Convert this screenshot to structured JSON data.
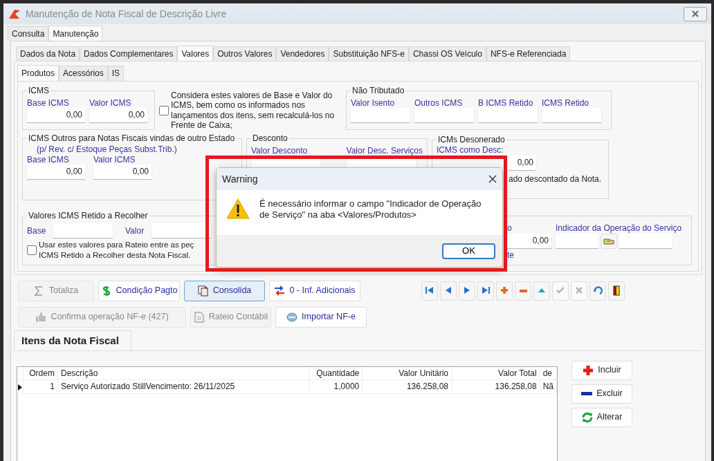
{
  "window": {
    "title": "Manutenção de Nota Fiscal de Descrição Livre"
  },
  "main_tabs": [
    {
      "label": "Consulta",
      "selected": false
    },
    {
      "label": "Manutenção",
      "selected": true
    }
  ],
  "section_tabs": [
    {
      "label": "Dados da Nota",
      "selected": false
    },
    {
      "label": "Dados Complementares",
      "selected": false
    },
    {
      "label": "Valores",
      "selected": true
    },
    {
      "label": "Outros Valores",
      "selected": false
    },
    {
      "label": "Vendedores",
      "selected": false
    },
    {
      "label": "Substituição NFS-e",
      "selected": false
    },
    {
      "label": "Chassi OS Veículo",
      "selected": false
    },
    {
      "label": "NFS-e Referenciada",
      "selected": false
    }
  ],
  "sub_tabs": [
    {
      "label": "Produtos",
      "selected": true
    },
    {
      "label": "Acessórios",
      "selected": false
    },
    {
      "label": "IS",
      "selected": false
    }
  ],
  "icms": {
    "title": "ICMS",
    "fields": [
      {
        "label": "Base ICMS",
        "value": "0,00"
      },
      {
        "label": "Valor ICMS",
        "value": "0,00"
      }
    ]
  },
  "considera": {
    "checked": false,
    "text": "Considera estes valores de Base e Valor do ICMS, bem como os informados nos lançamentos dos itens, sem recalculá-los no Frente de Caixa;"
  },
  "nao_tributado": {
    "title": "Não Tributado",
    "fields": [
      {
        "label": "Valor Isento"
      },
      {
        "label": "Outros ICMS"
      },
      {
        "label": "B ICMS Retido"
      },
      {
        "label": "ICMS Retido"
      }
    ]
  },
  "icms_outros": {
    "title": "ICMS Outros para Notas Fiscais vindas de outro Estado",
    "subtitle": "(p/ Rev. c/ Estoque Peças Subst.Trib.)",
    "fields": [
      {
        "label": "Base ICMS",
        "value": "0,00"
      },
      {
        "label": "Valor ICMS",
        "value": "0,00"
      }
    ]
  },
  "desconto": {
    "title": "Desconto",
    "fields": [
      {
        "label": "Valor Desconto"
      },
      {
        "label": "Valor Desc. Serviços"
      }
    ]
  },
  "icms_desonerado": {
    "title": "ICMs Desonerado",
    "label": "ICMS como Desc:",
    "value": "0,00",
    "note": "ado descontado da Nota."
  },
  "icms_retido": {
    "title": "Valores ICMS Retido a Recolher",
    "fields": [
      {
        "label": "Base"
      },
      {
        "label": "Valor"
      }
    ],
    "rateio_checked": false,
    "rateio_lines": [
      "Usar estes valores para Rateio entre as peç",
      "ICMS Retido a Recolher desta Nota Fiscal."
    ]
  },
  "servico": {
    "label": "o",
    "value": "0,00",
    "indicador_label": "Indicador da Operação do Serviço",
    "note": "te"
  },
  "action_rows": [
    [
      {
        "label": "Totaliza",
        "disabled": true,
        "focused": false
      },
      {
        "label": "Condição Pagto",
        "disabled": false,
        "focused": false
      },
      {
        "label": "Consolida",
        "disabled": false,
        "focused": true
      },
      {
        "label": "0 - Inf. Adicionais",
        "disabled": false,
        "focused": false
      }
    ],
    [
      {
        "label": "Confirma operação NF-e (427)",
        "disabled": true,
        "focused": false
      },
      {
        "label": "Rateio Contábil",
        "disabled": true,
        "focused": false
      },
      {
        "label": "Importar NF-e",
        "disabled": false,
        "focused": false
      }
    ]
  ],
  "navigator": [
    {
      "kind": "first",
      "disabled": false
    },
    {
      "kind": "prior",
      "disabled": false
    },
    {
      "kind": "next",
      "disabled": false
    },
    {
      "kind": "last",
      "disabled": false
    },
    {
      "kind": "insert",
      "disabled": false
    },
    {
      "kind": "delete",
      "disabled": false
    },
    {
      "kind": "edit",
      "disabled": false
    },
    {
      "kind": "post",
      "disabled": true
    },
    {
      "kind": "cancel",
      "disabled": true
    },
    {
      "kind": "refresh",
      "disabled": false
    },
    {
      "kind": "exit",
      "disabled": false
    }
  ],
  "items_tab": {
    "label": "Itens da Nota Fiscal"
  },
  "grid": {
    "columns": [
      "Ordem",
      "Descrição",
      "Quantidade",
      "Valor Unitário",
      "Valor Total",
      "de"
    ],
    "rows": [
      {
        "current": true,
        "cells": [
          "1",
          "Serviço Autorizado StillVencimento: 26/11/2025",
          "1,0000",
          "136.258,08",
          "136.258,08",
          "Nã"
        ]
      }
    ]
  },
  "item_buttons": [
    {
      "label": "Incluir"
    },
    {
      "label": "Excluir"
    },
    {
      "label": "Alterar"
    }
  ],
  "dialog": {
    "title": "Warning",
    "message": "É necessário informar o campo \"Indicador de Operação de Serviço\" na aba <Valores/Produtos>",
    "button": "OK"
  }
}
